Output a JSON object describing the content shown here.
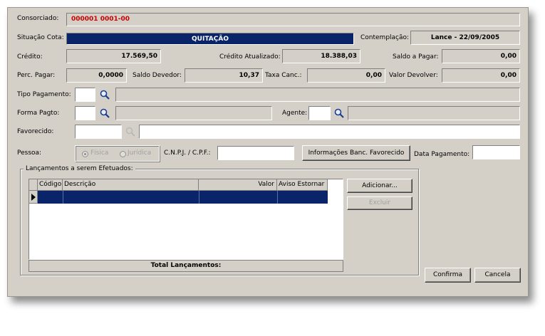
{
  "consorciado": {
    "label": "Consorciado:",
    "value": "000001 0001-00"
  },
  "situacao": {
    "label": "Situação Cota:",
    "value": "QUITAÇÃO"
  },
  "contemplacao": {
    "label": "Contemplação:",
    "value": "Lance - 22/09/2005"
  },
  "credito": {
    "label": "Crédito:",
    "value": "17.569,50"
  },
  "credito_atualizado": {
    "label": "Crédito Atualizado:",
    "value": "18.388,03"
  },
  "saldo_pagar": {
    "label": "Saldo a Pagar:",
    "value": "0,00"
  },
  "perc_pagar": {
    "label": "Perc. Pagar:",
    "value": "0,0000"
  },
  "saldo_devedor": {
    "label": "Saldo Devedor:",
    "value": "10,37"
  },
  "taxa_canc": {
    "label": "Taxa Canc.:",
    "value": "0,00"
  },
  "valor_devolver": {
    "label": "Valor Devolver:",
    "value": "0,00"
  },
  "tipo_pagamento": {
    "label": "Tipo Pagamento:",
    "code": "",
    "desc": ""
  },
  "forma_pagto": {
    "label": "Forma Pagto:",
    "code": "",
    "desc": ""
  },
  "agente": {
    "label": "Agente:",
    "code": "",
    "desc": ""
  },
  "favorecido": {
    "label": "Favorecido:",
    "code": "",
    "name": ""
  },
  "pessoa": {
    "label": "Pessoa:",
    "options": [
      "Física",
      "Jurídica"
    ],
    "selected": "Física"
  },
  "cnpj": {
    "label": "C.N.P.J. / C.P.F.:",
    "value": ""
  },
  "info_banc_button": "Informações Banc. Favorecido",
  "data_pagamento": {
    "label": "Data Pagamento:",
    "value": ""
  },
  "lancamentos": {
    "group_label": "Lançamentos a serem Efetuados:",
    "columns": [
      "Código",
      "Descrição",
      "Valor",
      "Aviso Estornar"
    ],
    "total_label": "Total Lançamentos:",
    "add_button": "Adicionar...",
    "delete_button": "Excluir"
  },
  "buttons": {
    "confirm": "Confirma",
    "cancel": "Cancela"
  },
  "colors": {
    "face": "#d4d0c8",
    "highlight_row": "#0a246a",
    "status_bar": "#0a246a",
    "consorciado_text": "#cc0000"
  },
  "icons": [
    "search-icon",
    "row-pointer-icon"
  ]
}
